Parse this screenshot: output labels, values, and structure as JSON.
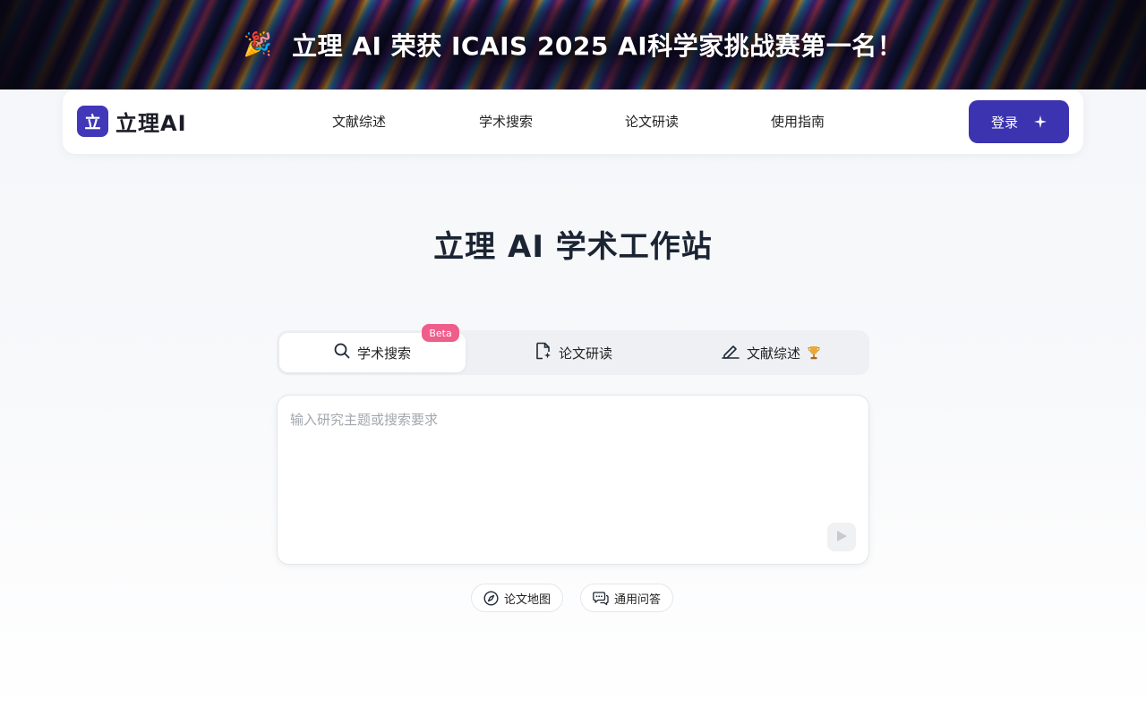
{
  "banner": {
    "text": "立理 AI 荣获 ICAIS 2025 AI科学家挑战赛第一名！",
    "icon": "party-popper-icon"
  },
  "navbar": {
    "logo_mark": "立",
    "logo_text": "立理AI",
    "items": [
      {
        "label": "文献综述"
      },
      {
        "label": "学术搜索"
      },
      {
        "label": "论文研读"
      },
      {
        "label": "使用指南"
      }
    ],
    "login_label": "登录",
    "login_icon": "sparkle-icon"
  },
  "main": {
    "title": "立理 AI 学术工作站",
    "tabs": [
      {
        "label": "学术搜索",
        "icon": "search-icon",
        "active": true,
        "badge": "Beta"
      },
      {
        "label": "论文研读",
        "icon": "file-sparkle-icon",
        "active": false
      },
      {
        "label": "文献综述",
        "icon": "pen-icon",
        "active": false,
        "extra_icon": "trophy-icon"
      }
    ],
    "input": {
      "placeholder": "输入研究主题或搜索要求",
      "value": ""
    },
    "send_icon": "send-icon",
    "chips": [
      {
        "label": "论文地图",
        "icon": "compass-icon"
      },
      {
        "label": "通用问答",
        "icon": "chat-bubbles-icon"
      }
    ]
  },
  "colors": {
    "brand": "#3c33b0",
    "beta_badge": "#ef5d8a",
    "banner_bg": "#0b0a1a"
  }
}
